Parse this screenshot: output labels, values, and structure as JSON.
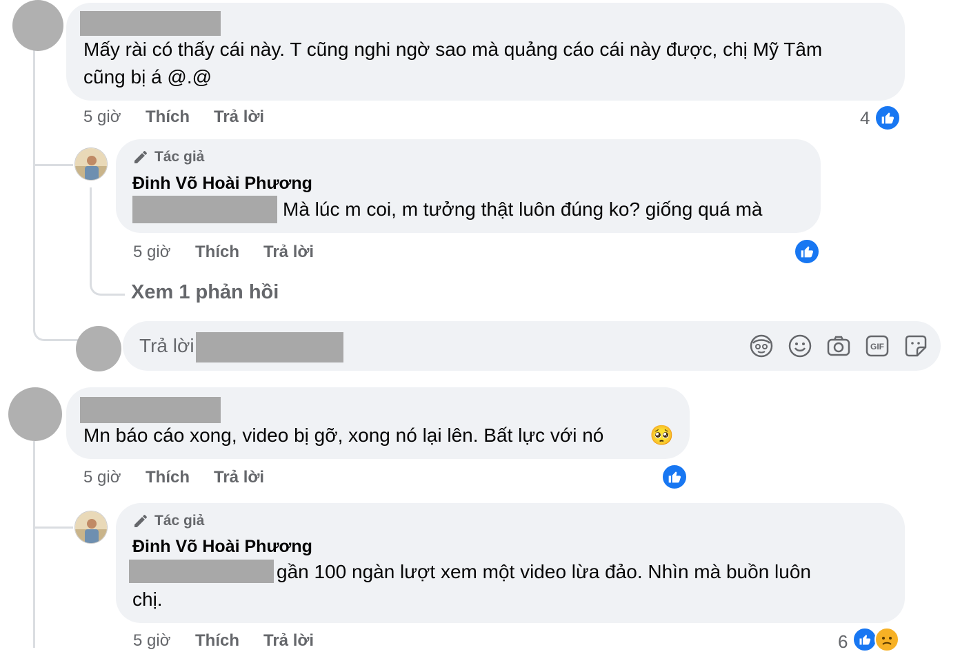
{
  "comments": [
    {
      "text_line1": "Mấy rài có thấy cái này. T cũng nghi ngờ sao mà quảng cáo cái này được, chị Mỹ Tâm",
      "text_line2": "cũng bị á @.@",
      "time": "5 giờ",
      "like": "Thích",
      "reply": "Trả lời",
      "reaction_count": "4",
      "replies": [
        {
          "author_tag": "Tác giả",
          "name": "Đinh Võ Hoài Phương",
          "text": "Mà lúc m coi, m tưởng thật luôn đúng ko? giống quá mà",
          "time": "5 giờ",
          "like": "Thích",
          "reply": "Trả lời"
        }
      ],
      "view_more": "Xem 1 phản hồi",
      "composer_placeholder": "Trả lời"
    },
    {
      "text": "Mn báo cáo xong, video bị gỡ, xong nó lại lên. Bất lực với nó",
      "emoji": "🥺",
      "time": "5 giờ",
      "like": "Thích",
      "reply": "Trả lời",
      "replies": [
        {
          "author_tag": "Tác giả",
          "name": "Đinh Võ Hoài Phương",
          "text_line1": "gần 100 ngàn lượt xem một video lừa đảo. Nhìn mà buồn luôn",
          "text_line2": "chị.",
          "time": "5 giờ",
          "like": "Thích",
          "reply": "Trả lời",
          "reaction_count": "6"
        }
      ]
    }
  ],
  "composer_icons": [
    "avatar-sticker-icon",
    "emoji-icon",
    "camera-icon",
    "gif-icon",
    "sticker-icon"
  ],
  "colors": {
    "accent": "#1877f2",
    "bubble": "#f0f2f5",
    "meta": "#65676b",
    "redaction": "#a8a8a8"
  }
}
